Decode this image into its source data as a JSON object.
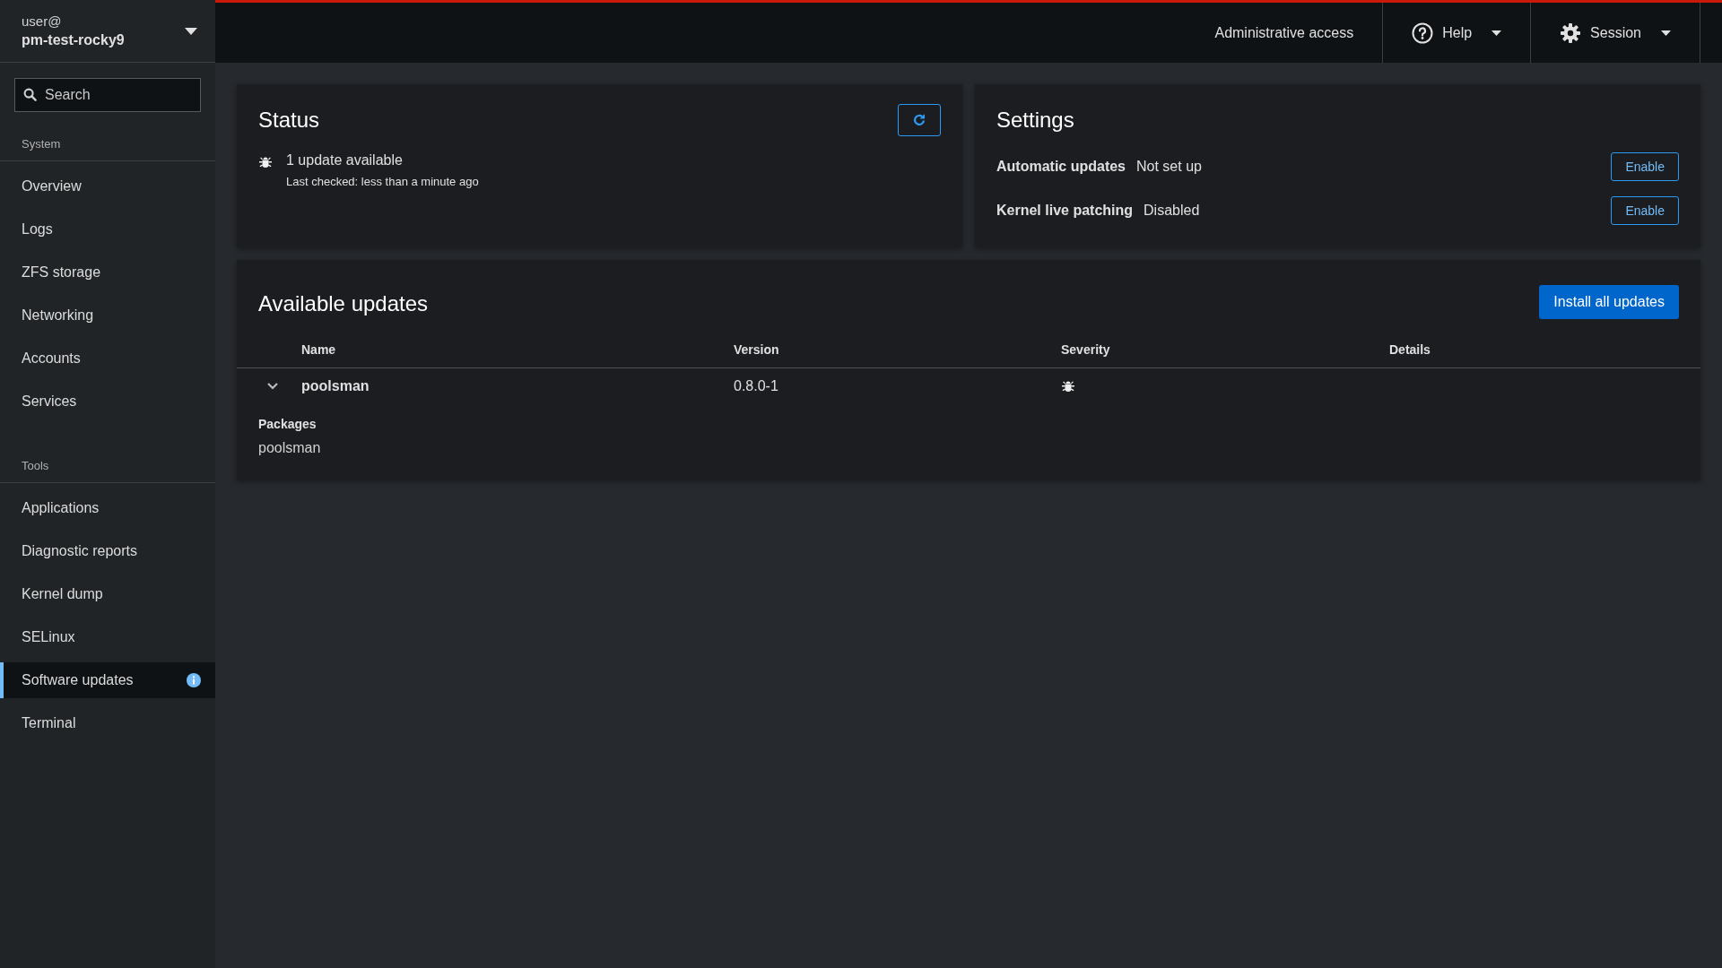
{
  "host": {
    "user": "user@",
    "name": "pm-test-rocky9"
  },
  "search": {
    "placeholder": "Search"
  },
  "nav": [
    {
      "heading": "System",
      "items": [
        {
          "label": "Overview",
          "selected": false,
          "badge": false
        },
        {
          "label": "Logs",
          "selected": false,
          "badge": false
        },
        {
          "label": "ZFS storage",
          "selected": false,
          "badge": false
        },
        {
          "label": "Networking",
          "selected": false,
          "badge": false
        },
        {
          "label": "Accounts",
          "selected": false,
          "badge": false
        },
        {
          "label": "Services",
          "selected": false,
          "badge": false
        }
      ]
    },
    {
      "heading": "Tools",
      "items": [
        {
          "label": "Applications",
          "selected": false,
          "badge": false
        },
        {
          "label": "Diagnostic reports",
          "selected": false,
          "badge": false
        },
        {
          "label": "Kernel dump",
          "selected": false,
          "badge": false
        },
        {
          "label": "SELinux",
          "selected": false,
          "badge": false
        },
        {
          "label": "Software updates",
          "selected": true,
          "badge": true
        },
        {
          "label": "Terminal",
          "selected": false,
          "badge": false
        }
      ]
    }
  ],
  "topbar": {
    "access": "Administrative access",
    "help": "Help",
    "session": "Session"
  },
  "status": {
    "title": "Status",
    "message": "1 update available",
    "checked": "Last checked: less than a minute ago"
  },
  "settings": {
    "title": "Settings",
    "rows": [
      {
        "label": "Automatic updates",
        "value": "Not set up",
        "button": "Enable"
      },
      {
        "label": "Kernel live patching",
        "value": "Disabled",
        "button": "Enable"
      }
    ]
  },
  "updates": {
    "title": "Available updates",
    "install": "Install all updates",
    "columns": [
      "Name",
      "Version",
      "Severity",
      "Details"
    ],
    "rows": [
      {
        "name": "poolsman",
        "version": "0.8.0-1",
        "expanded": true,
        "packages_label": "Packages",
        "packages": "poolsman"
      }
    ]
  }
}
